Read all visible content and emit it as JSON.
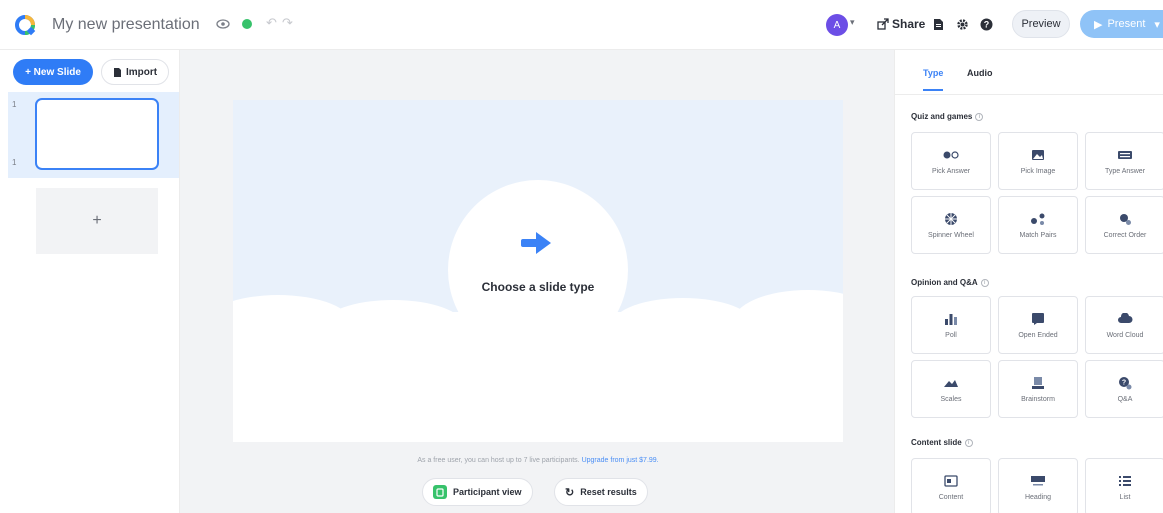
{
  "topbar": {
    "title": "My new presentation",
    "avatar_initial": "A",
    "share_label": "Share",
    "preview_label": "Preview",
    "present_label": "Present"
  },
  "sidebar": {
    "new_slide_label": "+ New Slide",
    "import_label": "Import",
    "slide_number": "1",
    "slide_number_bottom": "1",
    "add_slide_label": "+"
  },
  "canvas": {
    "prompt": "Choose a slide type",
    "free_note": "As a free user, you can host up to 7 live participants.",
    "upgrade_link": "Upgrade from just $7.99.",
    "participant_view_label": "Participant view",
    "reset_results_label": "Reset results"
  },
  "panel": {
    "tabs": [
      {
        "label": "Type",
        "active": true
      },
      {
        "label": "Audio",
        "active": false
      }
    ],
    "sections": [
      {
        "title": "Quiz and games",
        "items": [
          "Pick Answer",
          "Pick Image",
          "Type Answer",
          "Spinner Wheel",
          "Match Pairs",
          "Correct Order"
        ]
      },
      {
        "title": "Opinion and Q&A",
        "items": [
          "Poll",
          "Open Ended",
          "Word Cloud",
          "Scales",
          "Brainstorm",
          "Q&A"
        ]
      },
      {
        "title": "Content slide",
        "items": [
          "Content",
          "Heading",
          "List"
        ]
      }
    ]
  },
  "colors": {
    "accent": "#2f7cf6",
    "present": "#8fc3f7",
    "green": "#37c26b",
    "avatar": "#6c4ee6"
  },
  "icons": {
    "logo": "quiz-logo-icon",
    "eye": "eye-icon",
    "status": "online-dot-icon",
    "undo": "undo-icon",
    "redo": "redo-icon",
    "share": "share-icon",
    "document": "document-icon",
    "settings": "gear-icon",
    "help": "help-icon",
    "play": "play-icon",
    "arrow": "arrow-right-icon"
  }
}
